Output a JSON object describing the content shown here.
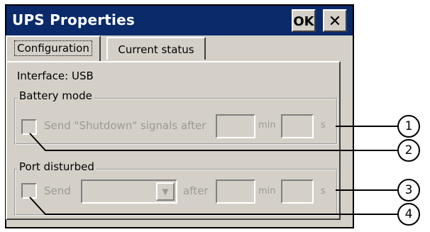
{
  "window": {
    "title": "UPS Properties",
    "ok_label": "OK",
    "close_label": "✕"
  },
  "tabs": [
    {
      "label": "Configuration",
      "active": true
    },
    {
      "label": "Current status",
      "active": false
    }
  ],
  "interface_text": "Interface: USB",
  "battery_mode": {
    "legend": "Battery mode",
    "checkbox_label": "Send \"Shutdown\" signals after",
    "min_value": "",
    "min_label": "min",
    "sec_value": "",
    "sec_label": "s"
  },
  "port_disturbed": {
    "legend": "Port disturbed",
    "send_label": "Send",
    "signal_selected": "",
    "after_label": "after",
    "min_value": "",
    "min_label": "min",
    "sec_value": "",
    "sec_label": "s"
  },
  "callouts": [
    "1",
    "2",
    "3",
    "4"
  ],
  "colors": {
    "title_bar": "#0a2a6a",
    "window_bg": "#d4d0c8",
    "disabled_text": "#9c9a94"
  }
}
